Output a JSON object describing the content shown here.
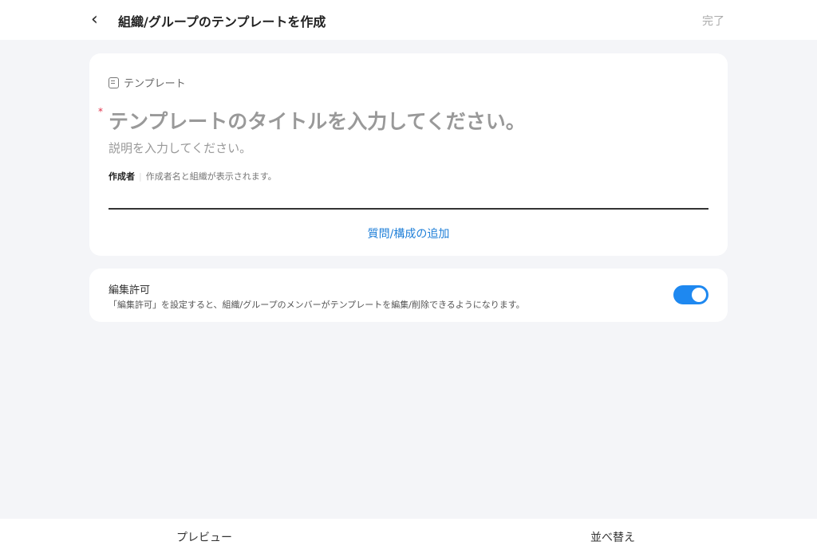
{
  "header": {
    "title": "組織/グループのテンプレートを作成",
    "done_label": "完了"
  },
  "template_card": {
    "type_label": "テンプレート",
    "title_placeholder": "テンプレートのタイトルを入力してください。",
    "required_mark": "*",
    "description_placeholder": "説明を入力してください。",
    "author_label": "作成者",
    "author_separator": "|",
    "author_hint": "作成者名と組織が表示されます。",
    "add_question_label": "質問/構成の追加"
  },
  "permission_card": {
    "title": "編集許可",
    "description": "「編集許可」を設定すると、組織/グループのメンバーがテンプレートを編集/削除できるようになります。",
    "enabled": true
  },
  "footer": {
    "preview_label": "プレビュー",
    "reorder_label": "並べ替え"
  },
  "colors": {
    "accent": "#1e88f0",
    "link": "#1f7fd8",
    "required": "#e0304a"
  }
}
